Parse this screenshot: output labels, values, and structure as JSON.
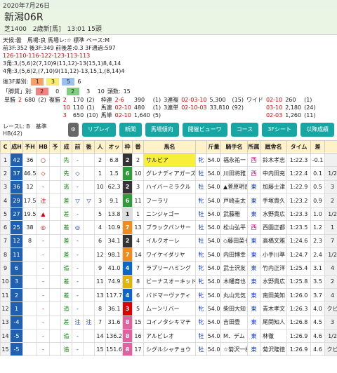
{
  "date": "2020年7月26日",
  "race": {
    "name": "新潟06R",
    "sub": "芝1400　2歳新[馬]　13:01 15頭"
  },
  "info_rows": [
    "天候:曇　馬場:良 馬場レ:☆ 標準 ペース:M",
    "前3F:352 後3F:349 前後差:0.3 3F通過:597",
    "126-110-116-122-123-113-113",
    "3角:3,(5,6)2(7,10)9(11,12)-13(15,1)8,4,14",
    "4角:3,(5,6)2,(7,10)9(11,12)-13,15,1,(8,14)4"
  ],
  "diff": {
    "label1": "後3F差別:",
    "v1": "1",
    "v2": "3",
    "v3": "5",
    "v4": "6",
    "label2": "「脚質」別:",
    "v5": "2",
    "v6": "0",
    "v7": "2",
    "v8": "3",
    "v9": "10",
    "label3": "頭数:",
    "v10": "15"
  },
  "pay_rows": [
    [
      "単勝",
      "2",
      "680",
      "(2)",
      "複勝",
      "2",
      "170",
      "(2)",
      "枠連",
      "2-6",
      "390",
      "(1)",
      "3連複",
      "02-03-10",
      "5,300",
      "(15)",
      "ワイド",
      "02-10",
      "260",
      "(1)"
    ],
    [
      "",
      "",
      "",
      "",
      "",
      "10",
      "110",
      "(1)",
      "馬連",
      "02-10",
      "480",
      "(1)",
      "3連単",
      "02-10-03",
      "33,810",
      "(92)",
      "",
      "03-10",
      "2,180",
      "(24)"
    ],
    [
      "",
      "",
      "",
      "",
      "",
      "3",
      "650",
      "(10)",
      "馬単",
      "02-10",
      "1,640",
      "(5)",
      "",
      "",
      "",
      "",
      "",
      "02-03",
      "1,260",
      "(11)"
    ]
  ],
  "toolbar": {
    "level": "レースL: B　基準HB(42)",
    "buttons": [
      "リプレイ",
      "新聞",
      "馬場傾向",
      "開催ビューワ",
      "コース",
      "3Fシート",
      "以降成績"
    ]
  },
  "headers": [
    "C",
    "成H",
    "予H",
    "HB",
    "予",
    "成",
    "前",
    "後",
    "人",
    "オッ",
    "枠",
    "番",
    "馬名",
    "",
    "斤量",
    "騎手名",
    "所属",
    "厩舎名",
    "タイム",
    "差",
    ""
  ],
  "rows": [
    {
      "rank": "1",
      "sh": "42",
      "yh": "36",
      "hb": "○",
      "mark": "",
      "sei": "先",
      "zen": "-",
      "go": "",
      "ninki": "2",
      "odds": "6.8",
      "waku": "2",
      "wc": "#333",
      "ban": "2",
      "name": "サルビア",
      "hl": true,
      "sex": "牝",
      "age": "2",
      "kin": "54.0",
      "jockey": "福永祐一",
      "shozoku": "西",
      "trainer": "鈴木孝志",
      "time": "1:22.3",
      "sa": "-0.1",
      "extra": ""
    },
    {
      "rank": "2",
      "sh": "37",
      "yh": "46.5",
      "hb": "◇",
      "mark": "",
      "sei": "先",
      "zen": "◇",
      "go": "",
      "ninki": "1",
      "odds": "1.5",
      "waku": "6",
      "wc": "#2e9c39",
      "ban": "10",
      "name": "グレナディアガーズ",
      "hl": false,
      "sex": "牡",
      "age": "2",
      "kin": "54.0",
      "jockey": "川田将雅",
      "shozoku": "西",
      "trainer": "中内田充",
      "time": "1:22.4",
      "sa": "0.1",
      "extra": "1/2"
    },
    {
      "rank": "3",
      "sh": "36",
      "yh": "12",
      "hb": "-",
      "mark": "",
      "sei": "逃",
      "zen": "-",
      "go": "",
      "ninki": "10",
      "odds": "62.3",
      "waku": "2",
      "wc": "#333",
      "ban": "3",
      "name": "ハイバーミラクル",
      "hl": false,
      "sex": "牡",
      "age": "2",
      "kin": "54.0",
      "jockey": "▲菅原明良",
      "shozoku": "東",
      "trainer": "加藤士津",
      "time": "1:22.9",
      "sa": "0.5",
      "extra": "3"
    },
    {
      "rank": "4",
      "sh": "29",
      "yh": "17.5",
      "hb": "注",
      "mark": "",
      "sei": "差",
      "zen": "▽",
      "go": "▽",
      "ninki": "3",
      "odds": "9.1",
      "waku": "6",
      "wc": "#2e9c39",
      "ban": "11",
      "name": "フーラリ",
      "hl": false,
      "sex": "牝",
      "age": "2",
      "kin": "54.0",
      "jockey": "戸崎圭太",
      "shozoku": "東",
      "trainer": "手塚貴久",
      "time": "1:23.2",
      "sa": "0.9",
      "extra": "2"
    },
    {
      "rank": "5",
      "sh": "27",
      "yh": "19.5",
      "hb": "▲",
      "mark": "",
      "sei": "差",
      "zen": "-",
      "go": "",
      "ninki": "5",
      "odds": "13.8",
      "waku": "1",
      "wc": "#ddd",
      "ban": "1",
      "name": "ニンジャゴー",
      "hl": false,
      "sex": "牡",
      "age": "2",
      "kin": "54.0",
      "jockey": "武藤雅",
      "shozoku": "東",
      "trainer": "水野貴広",
      "time": "1:23.3",
      "sa": "1.0",
      "extra": "1/2"
    },
    {
      "rank": "6",
      "sh": "25",
      "yh": "38",
      "hb": "◎",
      "mark": "",
      "sei": "差",
      "zen": "◎",
      "go": "",
      "ninki": "4",
      "odds": "10.9",
      "waku": "7",
      "wc": "#f08c1c",
      "ban": "13",
      "name": "ブラックパンサー",
      "hl": false,
      "sex": "牡",
      "age": "2",
      "kin": "54.0",
      "jockey": "松山弘平",
      "shozoku": "西",
      "trainer": "西園正都",
      "time": "1:23.5",
      "sa": "1.2",
      "extra": "1"
    },
    {
      "rank": "7",
      "sh": "12",
      "yh": "8",
      "hb": "-",
      "mark": "",
      "sei": "差",
      "zen": "-",
      "go": "",
      "ninki": "6",
      "odds": "34.1",
      "waku": "2",
      "wc": "#333",
      "ban": "4",
      "name": "イルクオーレ",
      "hl": false,
      "sex": "牡",
      "age": "2",
      "kin": "54.0",
      "jockey": "◇藤田菜七",
      "shozoku": "東",
      "trainer": "高橋文雅",
      "time": "1:24.6",
      "sa": "2.3",
      "extra": "7"
    },
    {
      "rank": "8",
      "sh": "11",
      "yh": "",
      "hb": "-",
      "mark": "",
      "sei": "差",
      "zen": "-",
      "go": "",
      "ninki": "12",
      "odds": "98.1",
      "waku": "7",
      "wc": "#f08c1c",
      "ban": "14",
      "name": "ワイケイダリヤ",
      "hl": false,
      "sex": "牝",
      "age": "2",
      "kin": "54.0",
      "jockey": "内田博幸",
      "shozoku": "東",
      "trainer": "小手川準",
      "time": "1:24.7",
      "sa": "2.4",
      "extra": "1/2"
    },
    {
      "rank": "9",
      "sh": "6",
      "yh": "",
      "hb": "-",
      "mark": "",
      "sei": "追",
      "zen": "-",
      "go": "",
      "ninki": "9",
      "odds": "41.0",
      "waku": "4",
      "wc": "#0a66c8",
      "ban": "7",
      "name": "ラブリーハミング",
      "hl": false,
      "sex": "牝",
      "age": "2",
      "kin": "54.0",
      "jockey": "武士沢友",
      "shozoku": "東",
      "trainer": "竹内正洋",
      "time": "1:25.4",
      "sa": "3.1",
      "extra": "4"
    },
    {
      "rank": "10",
      "sh": "3",
      "yh": "",
      "hb": "-",
      "mark": "",
      "sei": "差",
      "zen": "-",
      "go": "",
      "ninki": "11",
      "odds": "74.9",
      "waku": "5",
      "wc": "#e2b400",
      "ban": "8",
      "name": "ビーナスオーキッド",
      "hl": false,
      "sex": "牝",
      "age": "2",
      "kin": "54.0",
      "jockey": "木幡育也",
      "shozoku": "東",
      "trainer": "水野貴広",
      "time": "1:25.8",
      "sa": "3.5",
      "extra": "2"
    },
    {
      "rank": "11",
      "sh": "2",
      "yh": "",
      "hb": "-",
      "mark": "",
      "sei": "差",
      "zen": "-",
      "go": "",
      "ninki": "13",
      "odds": "117.7",
      "waku": "4",
      "wc": "#0a66c8",
      "ban": "6",
      "name": "バドマーヴァティ",
      "hl": false,
      "sex": "牝",
      "age": "2",
      "kin": "54.0",
      "jockey": "丸山元気",
      "shozoku": "東",
      "trainer": "南田美知",
      "time": "1:26.0",
      "sa": "3.7",
      "extra": "4"
    },
    {
      "rank": "12",
      "sh": "1",
      "yh": "",
      "hb": "-",
      "mark": "",
      "sei": "追",
      "zen": "-",
      "go": "",
      "ninki": "8",
      "odds": "36.1",
      "waku": "3",
      "wc": "#d00",
      "ban": "5",
      "name": "ムーンリバー",
      "hl": false,
      "sex": "牝",
      "age": "2",
      "kin": "54.0",
      "jockey": "柴田大知",
      "shozoku": "東",
      "trainer": "青木孝文",
      "time": "1:26.3",
      "sa": "4.0",
      "extra": "クビ"
    },
    {
      "rank": "13",
      "sh": "-4",
      "yh": "",
      "hb": "-",
      "mark": "",
      "sei": "差",
      "zen": "注",
      "go": "注",
      "ninki": "7",
      "odds": "31.6",
      "waku": "8",
      "wc": "#e060a0",
      "ban": "15",
      "name": "コイノタシキマチ",
      "hl": false,
      "sex": "牝",
      "age": "2",
      "kin": "54.0",
      "jockey": "吉田豊",
      "shozoku": "東",
      "trainer": "尾関知人",
      "time": "1:26.8",
      "sa": "4.5",
      "extra": "3"
    },
    {
      "rank": "14",
      "sh": "-5",
      "yh": "",
      "hb": "-",
      "mark": "",
      "sei": "追",
      "zen": "-",
      "go": "",
      "ninki": "14",
      "odds": "136.2",
      "waku": "8",
      "wc": "#e060a0",
      "ban": "16",
      "name": "アルビレオ",
      "hl": false,
      "sex": "牡",
      "age": "2",
      "kin": "54.0",
      "jockey": "M．デム",
      "shozoku": "東",
      "trainer": "林徹",
      "time": "1:26.9",
      "sa": "4.6",
      "extra": "1/2"
    },
    {
      "rank": "15",
      "sh": "-5",
      "yh": "",
      "hb": "-",
      "mark": "",
      "sei": "追",
      "zen": "-",
      "go": "",
      "ninki": "15",
      "odds": "151.6",
      "waku": "8",
      "wc": "#e060a0",
      "ban": "17",
      "name": "シグルシャチョウ",
      "hl": false,
      "sex": "牡",
      "age": "2",
      "kin": "54.0",
      "jockey": "☆菊沢一樹",
      "shozoku": "東",
      "trainer": "菊沢隆徳",
      "time": "1:26.9",
      "sa": "4.6",
      "extra": "クビ"
    }
  ]
}
